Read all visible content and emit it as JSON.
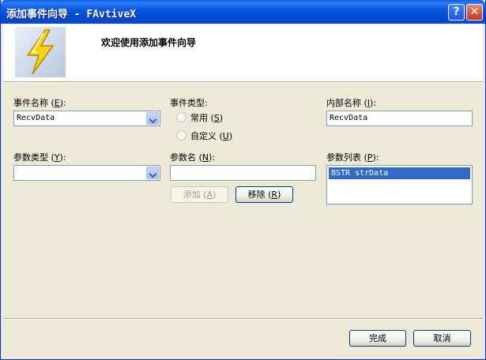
{
  "window": {
    "title": "添加事件向导 - FAvtiveX",
    "help_glyph": "?",
    "close_glyph": "✕"
  },
  "banner": {
    "title": "欢迎使用添加事件向导"
  },
  "form": {
    "event_name": {
      "label_prefix": "事件名称 (",
      "hotkey": "E",
      "label_suffix": "):",
      "value": "RecvData"
    },
    "event_type": {
      "label": "事件类型:",
      "options": [
        {
          "label_prefix": "常用 (",
          "hotkey": "S",
          "label_suffix": ")"
        },
        {
          "label_prefix": "自定义 (",
          "hotkey": "U",
          "label_suffix": ")"
        }
      ]
    },
    "internal_name": {
      "label_prefix": "内部名称 (",
      "hotkey": "I",
      "label_suffix": "):",
      "value": "RecvData"
    },
    "param_type": {
      "label_prefix": "参数类型 (",
      "hotkey": "Y",
      "label_suffix": "):",
      "value": ""
    },
    "param_name": {
      "label_prefix": "参数名 (",
      "hotkey": "N",
      "label_suffix": "):",
      "value": ""
    },
    "param_list": {
      "label_prefix": "参数列表 (",
      "hotkey": "P",
      "label_suffix": "):",
      "items": [
        "BSTR strData"
      ]
    },
    "add_button": {
      "label_prefix": "添加 (",
      "hotkey": "A",
      "label_suffix": ")"
    },
    "remove_button": {
      "label_prefix": "移除 (",
      "hotkey": "R",
      "label_suffix": ")"
    }
  },
  "footer": {
    "finish_label": "完成",
    "cancel_label": "取消"
  }
}
